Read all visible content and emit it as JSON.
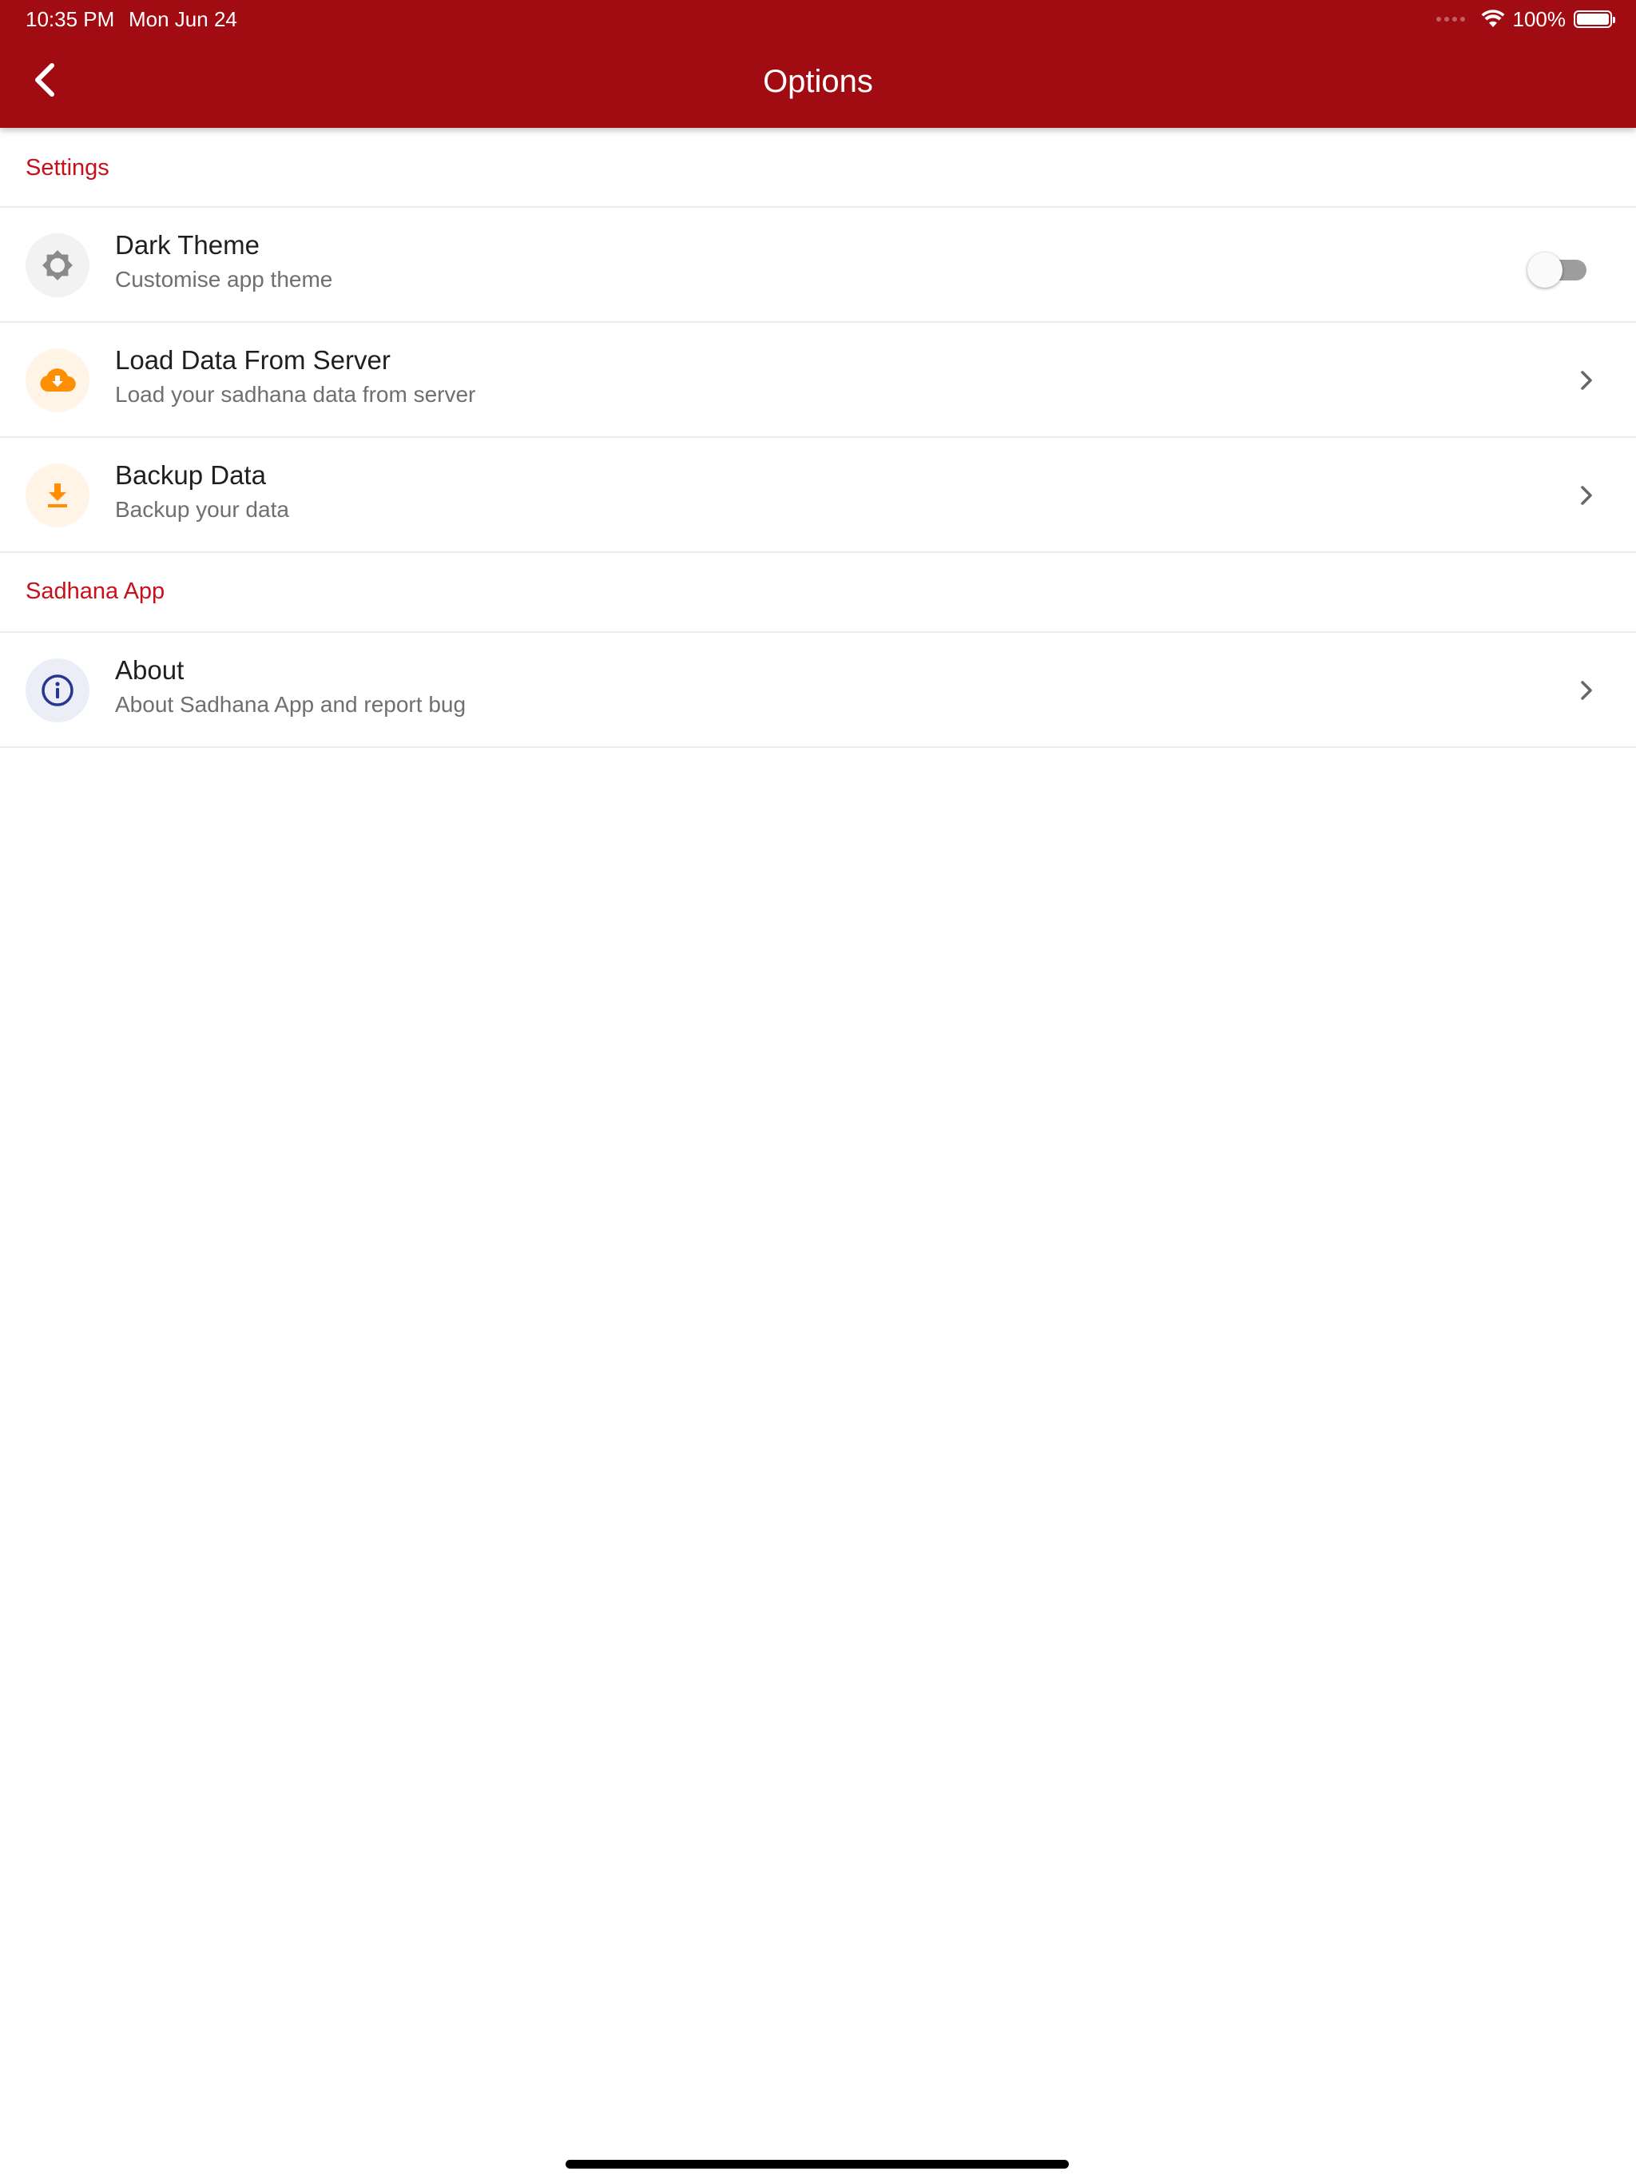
{
  "status_bar": {
    "time": "10:35 PM",
    "date": "Mon Jun 24",
    "battery_text": "100%"
  },
  "header": {
    "title": "Options",
    "background_color": "#a00c12"
  },
  "sections": [
    {
      "label": "Settings",
      "items": [
        {
          "title": "Dark Theme",
          "subtitle": "Customise app theme",
          "icon": "brightness-icon",
          "control": "toggle",
          "toggle_on": false
        },
        {
          "title": "Load Data From Server",
          "subtitle": "Load your sadhana data from server",
          "icon": "cloud-download-icon",
          "control": "chevron"
        },
        {
          "title": "Backup Data",
          "subtitle": "Backup your data",
          "icon": "download-icon",
          "control": "chevron"
        }
      ]
    },
    {
      "label": "Sadhana App",
      "items": [
        {
          "title": "About",
          "subtitle": "About Sadhana App and report bug",
          "icon": "info-icon",
          "control": "chevron"
        }
      ]
    }
  ],
  "colors": {
    "accent": "#c8101c",
    "orange_icon": "#ff8f00",
    "info_icon": "#283593"
  }
}
